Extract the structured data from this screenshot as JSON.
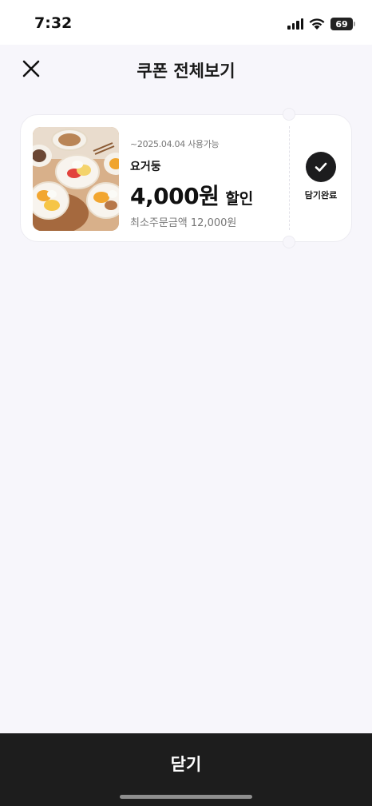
{
  "status_bar": {
    "time": "7:32",
    "battery_level": "69",
    "icons": [
      "signal-icon",
      "wifi-icon",
      "battery-icon"
    ]
  },
  "header": {
    "title": "쿠폰 전체보기",
    "close_icon": "close-icon"
  },
  "coupons": [
    {
      "expiry": "~2025.04.04 사용가능",
      "store_name": "요거둥",
      "discount_amount": "4,000원",
      "discount_suffix": "할인",
      "min_order": "최소주문금액 12,000원",
      "status_label": "담기완료",
      "status_icon": "check-icon",
      "image_icon": "food-photo"
    }
  ],
  "bottom_button": {
    "label": "닫기"
  },
  "colors": {
    "background": "#f7f6fb",
    "card": "#ffffff",
    "accent_dark": "#1c1c1e",
    "muted_text": "#777777"
  }
}
